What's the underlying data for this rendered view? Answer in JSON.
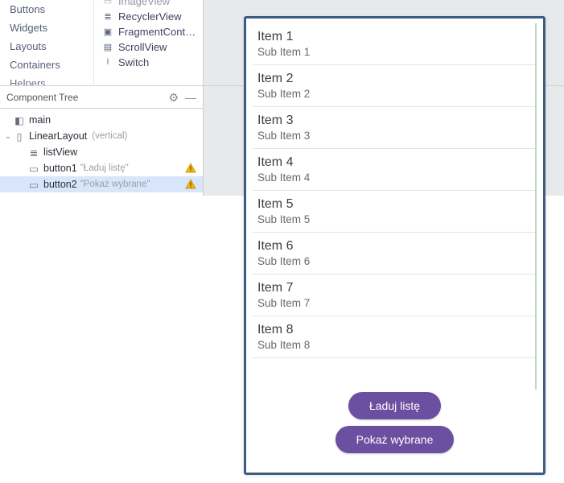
{
  "palette": {
    "categories": [
      "Buttons",
      "Widgets",
      "Layouts",
      "Containers",
      "Helpers"
    ],
    "items": [
      {
        "icon": "imageview",
        "label": "ImageView"
      },
      {
        "icon": "recycler",
        "label": "RecyclerView"
      },
      {
        "icon": "fragment",
        "label": "FragmentContai…"
      },
      {
        "icon": "scroll",
        "label": "ScrollView"
      },
      {
        "icon": "switch",
        "label": "Switch"
      }
    ]
  },
  "component_tree": {
    "title": "Component Tree",
    "root": {
      "label": "main",
      "children": [
        {
          "label": "LinearLayout",
          "hint": "(vertical)",
          "children": [
            {
              "label": "listView"
            },
            {
              "label": "button1",
              "text": "\"Ładuj listę\"",
              "warn": true
            },
            {
              "label": "button2",
              "text": "\"Pokaż wybrane\"",
              "warn": true,
              "selected": true
            }
          ]
        }
      ]
    }
  },
  "preview": {
    "list": [
      {
        "title": "Item 1",
        "sub": "Sub Item 1"
      },
      {
        "title": "Item 2",
        "sub": "Sub Item 2"
      },
      {
        "title": "Item 3",
        "sub": "Sub Item 3"
      },
      {
        "title": "Item 4",
        "sub": "Sub Item 4"
      },
      {
        "title": "Item 5",
        "sub": "Sub Item 5"
      },
      {
        "title": "Item 6",
        "sub": "Sub Item 6"
      },
      {
        "title": "Item 7",
        "sub": "Sub Item 7"
      },
      {
        "title": "Item 8",
        "sub": "Sub Item 8"
      }
    ],
    "button1": "Ładuj listę",
    "button2": "Pokaż wybrane"
  }
}
